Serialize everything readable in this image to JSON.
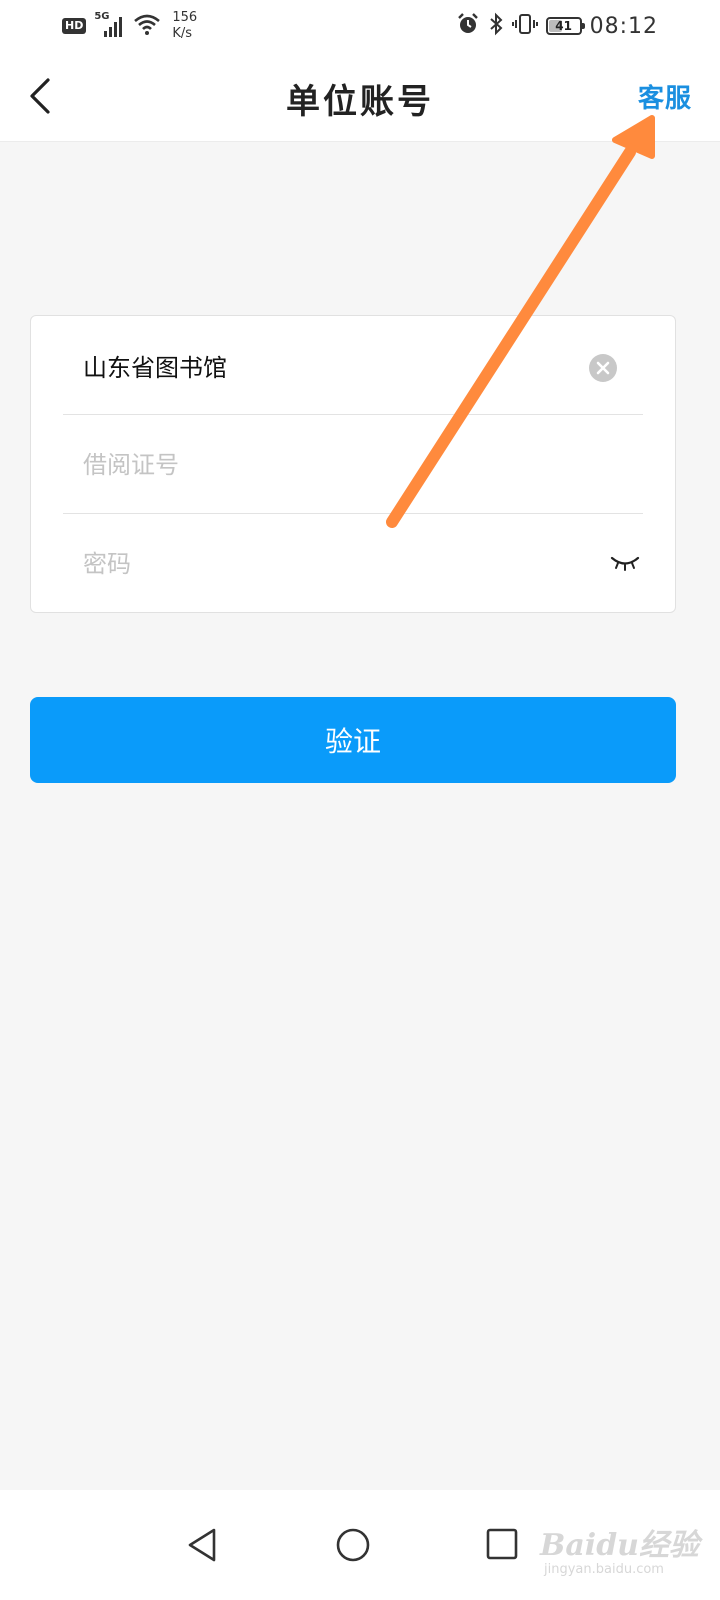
{
  "status_bar": {
    "hd": "HD",
    "network": "5G",
    "speed_value": "156",
    "speed_unit": "K/s",
    "battery": "41",
    "battery_level": 0.41,
    "time": "08:12"
  },
  "header": {
    "title": "单位账号",
    "service_label": "客服"
  },
  "form": {
    "institution": {
      "value": "山东省图书馆",
      "placeholder": ""
    },
    "card_number": {
      "value": "",
      "placeholder": "借阅证号"
    },
    "password": {
      "value": "",
      "placeholder": "密码"
    }
  },
  "verify_button": {
    "label": "验证"
  },
  "annotation_color": "#ff8a3d",
  "accent_color": "#0a9bfa",
  "link_color": "#1a8fe0",
  "watermark": {
    "logo": "Baidu经验",
    "url": "jingyan.baidu.com"
  },
  "icons": {
    "back": "chevron-left-icon",
    "clear": "clear-circle-icon",
    "password_toggle": "eye-closed-icon",
    "nav_back": "triangle-back-icon",
    "nav_home": "circle-home-icon",
    "nav_recent": "square-recent-icon"
  }
}
